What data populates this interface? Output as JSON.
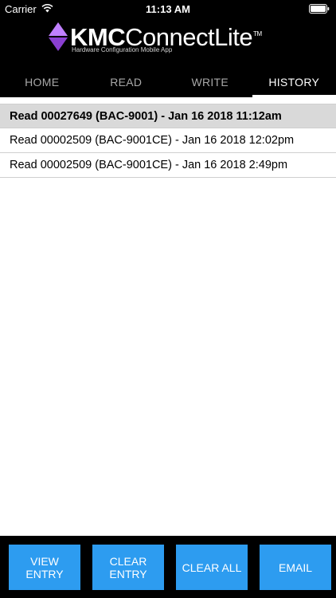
{
  "status_bar": {
    "carrier": "Carrier",
    "time": "11:13 AM"
  },
  "header": {
    "logo_bold": "KMC",
    "logo_light": "ConnectLite",
    "trademark": "TM",
    "tagline": "Hardware Configuration Mobile App",
    "logo_colors": {
      "top": "#c080ff",
      "bottom": "#8a3fd1"
    }
  },
  "tabs": [
    {
      "label": "HOME"
    },
    {
      "label": "READ"
    },
    {
      "label": "WRITE"
    },
    {
      "label": "HISTORY",
      "active": true
    }
  ],
  "history": [
    {
      "text": "Read 00027649 (BAC-9001) - Jan 16 2018 11:12am",
      "selected": true
    },
    {
      "text": "Read 00002509 (BAC-9001CE) - Jan 16 2018 12:02pm",
      "selected": false
    },
    {
      "text": "Read 00002509 (BAC-9001CE) - Jan 16 2018 2:49pm",
      "selected": false
    }
  ],
  "actions": {
    "view_entry": "VIEW ENTRY",
    "clear_entry": "CLEAR ENTRY",
    "clear_all": "CLEAR ALL",
    "email": "EMAIL"
  },
  "colors": {
    "accent": "#2d9cf0",
    "header_bg": "#000000",
    "selected_row": "#d9d9d9"
  }
}
